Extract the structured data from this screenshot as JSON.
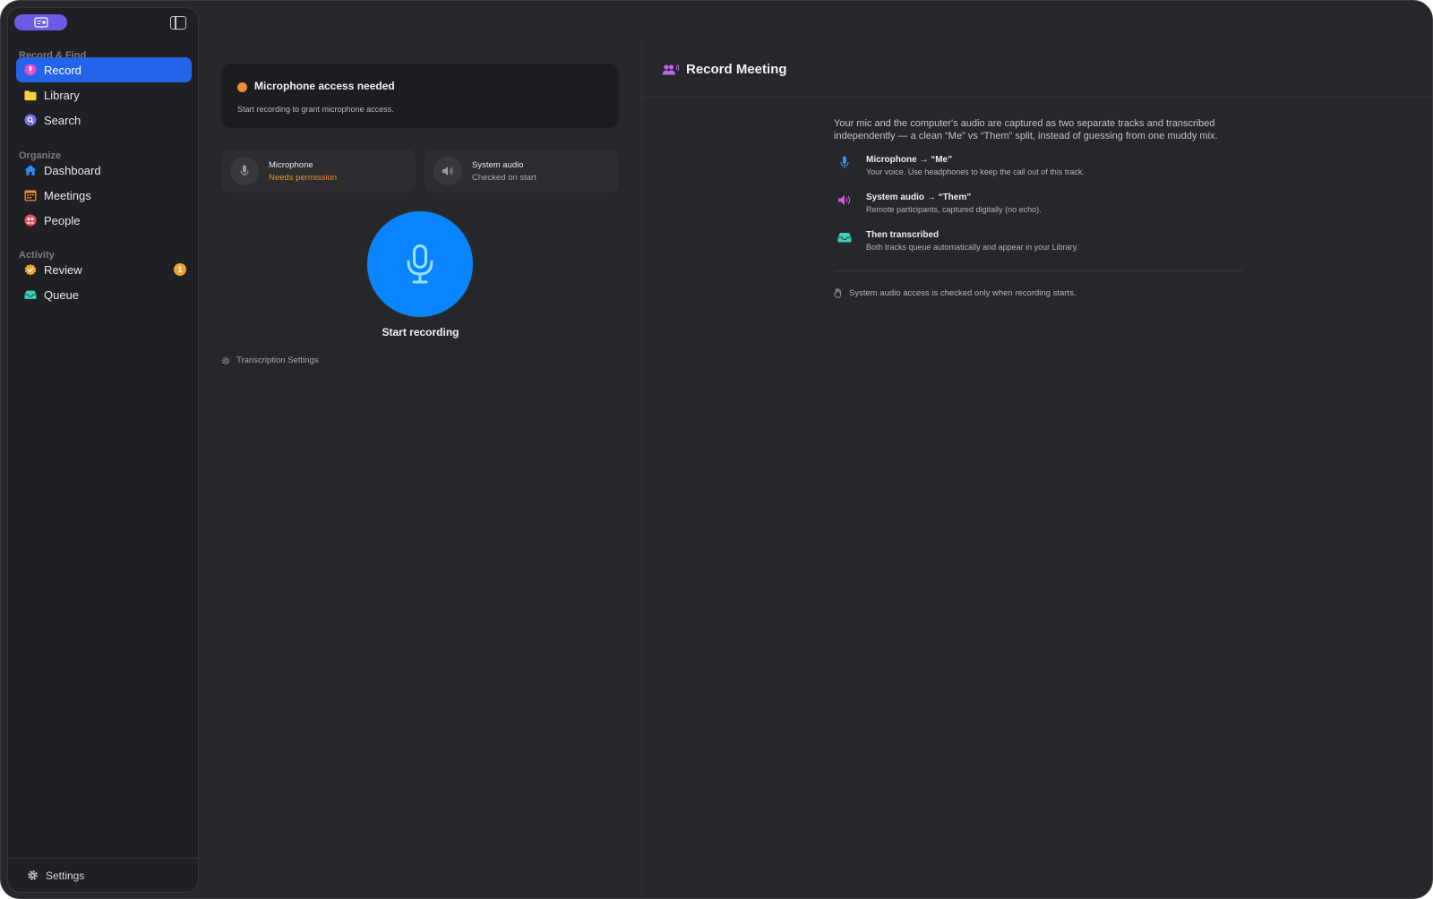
{
  "sidebar": {
    "sections": [
      {
        "label": "Record & Find"
      },
      {
        "label": "Organize"
      },
      {
        "label": "Activity"
      }
    ],
    "items": [
      {
        "label": "Record",
        "icon": "record-icon",
        "active": true
      },
      {
        "label": "Library",
        "icon": "folder-icon"
      },
      {
        "label": "Search",
        "icon": "search-icon"
      },
      {
        "label": "Dashboard",
        "icon": "house-icon"
      },
      {
        "label": "Meetings",
        "icon": "calendar-icon"
      },
      {
        "label": "People",
        "icon": "people-icon"
      },
      {
        "label": "Review",
        "icon": "checkmark-seal-icon",
        "badge": "1"
      },
      {
        "label": "Queue",
        "icon": "tray-icon"
      }
    ],
    "footer_label": "Settings"
  },
  "alert": {
    "title": "Microphone access needed",
    "subtitle": "Start recording to grant microphone access."
  },
  "sources": [
    {
      "title": "Microphone",
      "status": "Needs permission",
      "icon": "microphone-icon"
    },
    {
      "title": "System audio",
      "status": "Checked on start",
      "icon": "speaker-icon"
    }
  ],
  "record_button_label": "Start recording",
  "transcription_settings_label": "Transcription Settings",
  "right_panel": {
    "title": "Record Meeting",
    "description": "Your mic and the computer's audio are captured as two separate tracks and transcribed independently — a clean “Me” vs “Them” split, instead of guessing from one muddy mix.",
    "features": [
      {
        "title": "Microphone → “Me”",
        "subtitle": "Your voice. Use headphones to keep the call out of this track.",
        "icon": "microphone-icon"
      },
      {
        "title": "System audio → “Them”",
        "subtitle": "Remote participants, captured digitally (no echo).",
        "icon": "speaker-icon"
      },
      {
        "title": "Then transcribed",
        "subtitle": "Both tracks queue automatically and appear in your Library.",
        "icon": "tray-icon"
      }
    ],
    "note": "System audio access is checked only when recording starts."
  },
  "colors": {
    "accent": "#2563eb",
    "record_button": "#0a84ff",
    "warning": "#f08c33",
    "app_pill": "#6d5ae6"
  }
}
